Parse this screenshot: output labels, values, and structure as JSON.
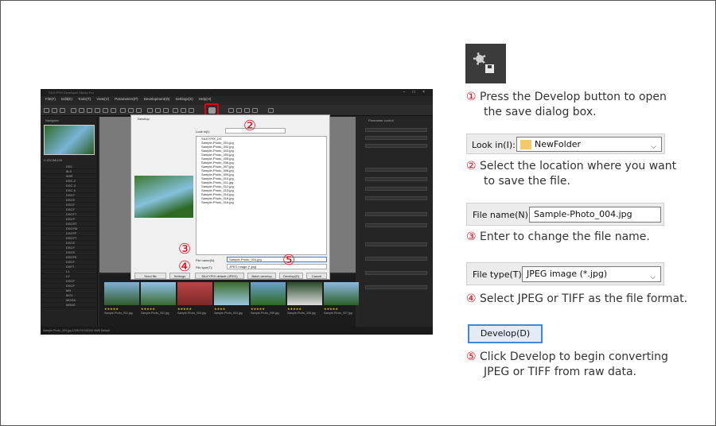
{
  "app": {
    "title": "SILKYPIX Developer Studio Pro",
    "menu": [
      "File(F)",
      "Edit(E)",
      "Tools(T)",
      "View(V)",
      "Parameters(P)",
      "Development(D)",
      "Settings(S)",
      "Help(H)"
    ],
    "navigator_label": "Navigator",
    "parameter_panel_label": "Parameter control",
    "folder_path": "C:\\DCIM\\100",
    "folders": [
      "DSC",
      "8LS",
      "9MR",
      "DSC-2",
      "DSC-3",
      "DSC-6",
      "DSCF",
      "DSCE",
      "DSCF",
      "DSCF",
      "DSCFT",
      "DSCP",
      "DSCRT",
      "DSCFM",
      "DSCPF",
      "DSCFT",
      "DSCE",
      "DSCF",
      "DSCE",
      "DSCFE",
      "DSCF",
      "DSFT",
      "L1",
      "L2",
      "DSCF",
      "DSCF",
      "MN",
      "MO1",
      "MODA",
      "MRAS"
    ],
    "statusbar_text": "Sample-Photo_004.jpg  1/250  F8  ISO100  AWB  Default",
    "thumbnails": [
      {
        "name": "Sample-Photo_001.jpg",
        "rating": "★★★★★"
      },
      {
        "name": "Sample-Photo_002.jpg",
        "rating": "★★★★★"
      },
      {
        "name": "Sample-Photo_003.jpg",
        "rating": "★★★★★"
      },
      {
        "name": "Sample-Photo_004.jpg",
        "rating": "★★★★"
      },
      {
        "name": "Sample-Photo_005.jpg",
        "rating": "★★★★★"
      },
      {
        "name": "Sample-Photo_006.jpg",
        "rating": "★★★★★"
      },
      {
        "name": "Sample-Photo_007.jpg",
        "rating": "★★★★★"
      }
    ]
  },
  "dialog": {
    "title": "Develop",
    "look_in_label": "Look in(I):",
    "look_in_value": "NewFolder",
    "files": [
      "SILKYPIX_DS",
      "Sample-Photo_001.jpg",
      "Sample-Photo_002.jpg",
      "Sample-Photo_003.jpg",
      "Sample-Photo_004.jpg",
      "Sample-Photo_005.jpg",
      "Sample-Photo_006.jpg",
      "Sample-Photo_007.jpg",
      "Sample-Photo_008.jpg",
      "Sample-Photo_009.jpg",
      "Sample-Photo_010.jpg",
      "Sample-Photo_011.jpg",
      "Sample-Photo_012.jpg",
      "Sample-Photo_013.jpg",
      "Sample-Photo_014.jpg",
      "Sample-Photo_015.jpg",
      "Sample-Photo_016.jpg"
    ],
    "file_name_label": "File name(N):",
    "file_name_value": "Sample-Photo_004.jpg",
    "file_type_label": "File type(T):",
    "file_type_value": "JPEG image (*.jpg)",
    "buttons": {
      "send_to": "Send file",
      "settings": "Settings",
      "preset": "SILKYPIX default (JPEG)",
      "batch": "Batch develop",
      "develop": "Develop(D)",
      "cancel": "Cancel"
    }
  },
  "callouts": [
    "①",
    "②",
    "③",
    "④",
    "⑤"
  ],
  "steps": [
    {
      "num": "①",
      "line1": "Press the Develop button to open",
      "line2": "the save dialog box."
    },
    {
      "num": "②",
      "line1": "Select the location where you want",
      "line2": "to save the file."
    },
    {
      "num": "③",
      "line1": "Enter to change the file name.",
      "line2": ""
    },
    {
      "num": "④",
      "line1": "Select JPEG or TIFF as the file format.",
      "line2": ""
    },
    {
      "num": "⑤",
      "line1": "Click Develop to begin converting",
      "line2": "JPEG or TIFF from raw data."
    }
  ],
  "widgets": {
    "look_in_label": "Look in(I):",
    "look_in_value": "NewFolder",
    "file_name_label": "File name(N):",
    "file_name_value": "Sample-Photo_004.jpg",
    "file_type_label": "File type(T):",
    "file_type_value": "JPEG image (*.jpg)",
    "develop_button": "Develop(D)"
  },
  "icons": {
    "develop": "develop-save-icon",
    "folder": "folder-icon",
    "dropdown": "chevron-down-icon"
  },
  "colors": {
    "callout": "#e60012",
    "app_bg": "#262626",
    "button_border": "#3c8ad8"
  }
}
